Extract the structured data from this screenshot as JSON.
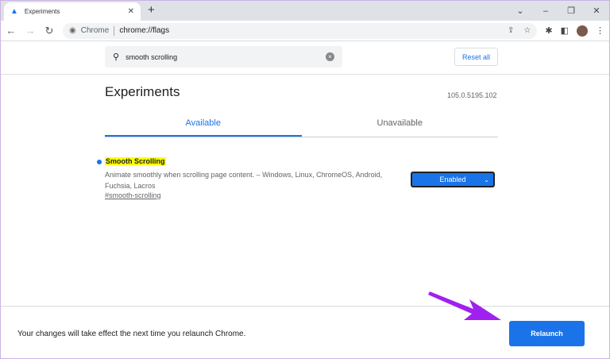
{
  "browser": {
    "tab_title": "Experiments",
    "omnibox_site": "Chrome",
    "omnibox_url": "chrome://flags"
  },
  "search": {
    "value": "smooth scrolling",
    "reset_label": "Reset all"
  },
  "page": {
    "title": "Experiments",
    "version": "105.0.5195.102",
    "tabs": [
      {
        "label": "Available"
      },
      {
        "label": "Unavailable"
      }
    ]
  },
  "flag": {
    "name": "Smooth Scrolling",
    "description": "Animate smoothly when scrolling page content. – Windows, Linux, ChromeOS, Android, Fuchsia, Lacros",
    "link": "#smooth-scrolling",
    "value": "Enabled"
  },
  "footer": {
    "message": "Your changes will take effect the next time you relaunch Chrome.",
    "relaunch_label": "Relaunch"
  },
  "colors": {
    "accent": "#1a73e8",
    "highlight": "#ffff00",
    "annotation": "#a020f0"
  }
}
